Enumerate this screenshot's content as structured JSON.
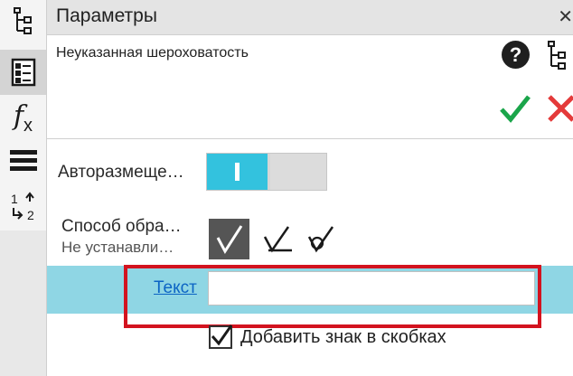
{
  "header": {
    "title": "Параметры",
    "close_glyph": "✕"
  },
  "subtitle": "Неуказанная шероховатость",
  "icons": {
    "left_toolbar": [
      "tree-icon",
      "properties-icon",
      "fx-icon",
      "layers-icon",
      "swap-icon"
    ],
    "fx_text": "f",
    "fx_sub": "x",
    "swap_top": "1",
    "swap_bottom": "2",
    "help_glyph": "?"
  },
  "fields": {
    "auto_placement": {
      "label": "Авторазмеще…",
      "value": "on"
    },
    "method": {
      "label": "Способ обра…",
      "value_text": "Не устанавли…",
      "options": [
        "v-mark",
        "v-check",
        "v-circle"
      ],
      "selected_index": 0
    },
    "text": {
      "label": "Текст",
      "value": ""
    },
    "add_in_brackets": {
      "label": "Добавить знак в скобках",
      "checked": true
    }
  },
  "colors": {
    "accent": "#33c2de",
    "highlight_row": "#8fd6e4",
    "ok": "#1aa54a",
    "cancel": "#e43a3a",
    "red_frame": "#d3131f",
    "link": "#0c64c4"
  }
}
